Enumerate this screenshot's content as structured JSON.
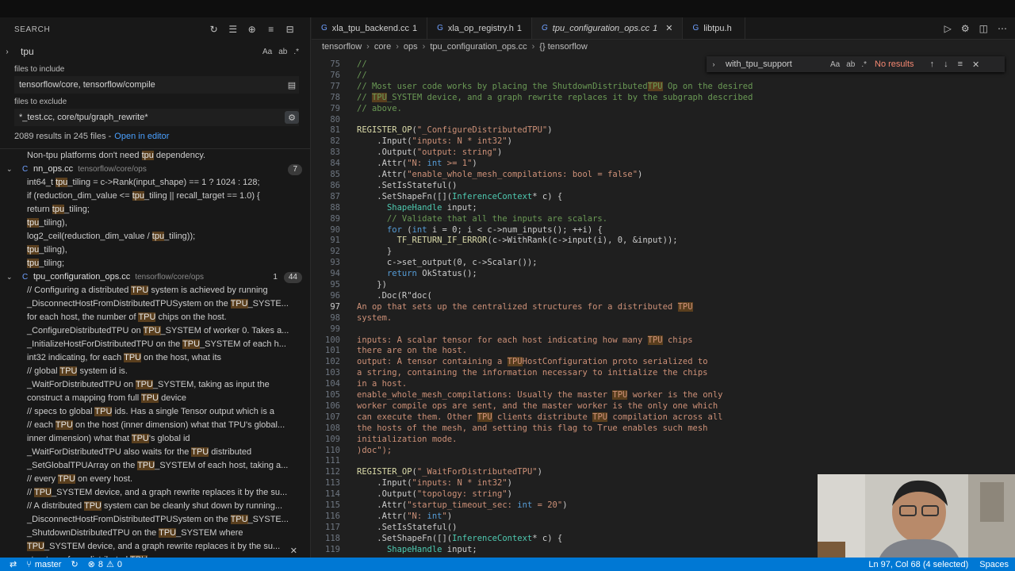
{
  "sidebar": {
    "title": "SEARCH",
    "query": "tpu",
    "include_label": "files to include",
    "include_value": "tensorflow/core, tensorflow/compile",
    "exclude_label": "files to exclude",
    "exclude_value": "*_test.cc, core/tpu/graph_rewrite*",
    "summary": "2089 results in 245 files -",
    "open_in_editor": "Open in editor",
    "results": [
      {
        "kind": "line",
        "pre": "Non-tpu platforms don't need ",
        "hl": "tpu",
        "post": " dependency."
      },
      {
        "kind": "file",
        "name": "nn_ops.cc",
        "path": "tensorflow/core/ops",
        "badge": "7"
      },
      {
        "kind": "line",
        "pre": "int64_t ",
        "hl": "tpu",
        "post": "_tiling = c->Rank(input_shape) == 1 ? 1024 : 128;"
      },
      {
        "kind": "line",
        "pre": "if (reduction_dim_value <= ",
        "hl": "tpu",
        "post": "_tiling || recall_target == 1.0) {"
      },
      {
        "kind": "line",
        "pre": "return ",
        "hl": "tpu",
        "post": "_tiling;"
      },
      {
        "kind": "line",
        "pre": "",
        "hl": "tpu",
        "post": "_tiling),"
      },
      {
        "kind": "line",
        "pre": "log2_ceil(reduction_dim_value / ",
        "hl": "tpu",
        "post": "_tiling));"
      },
      {
        "kind": "line",
        "pre": "",
        "hl": "tpu",
        "post": "_tiling),"
      },
      {
        "kind": "line",
        "pre": "",
        "hl": "tpu",
        "post": "_tiling;"
      },
      {
        "kind": "file",
        "name": "tpu_configuration_ops.cc",
        "path": "tensorflow/core/ops",
        "num": "1",
        "badge": "44"
      },
      {
        "kind": "line",
        "pre": "// Configuring a distributed ",
        "hl": "TPU",
        "post": " system is achieved by running"
      },
      {
        "kind": "line",
        "pre": "_DisconnectHostFromDistributedTPUSystem on the ",
        "hl": "TPU",
        "post": "_SYSTE..."
      },
      {
        "kind": "line",
        "pre": "for each host, the number of ",
        "hl": "TPU",
        "post": " chips on the host."
      },
      {
        "kind": "line",
        "pre": "_ConfigureDistributedTPU on ",
        "hl": "TPU",
        "post": "_SYSTEM of worker 0. Takes a..."
      },
      {
        "kind": "line",
        "pre": "_InitializeHostForDistributedTPU on the ",
        "hl": "TPU",
        "post": "_SYSTEM of each h..."
      },
      {
        "kind": "line",
        "pre": "int32 indicating, for each ",
        "hl": "TPU",
        "post": " on the host, what its"
      },
      {
        "kind": "line",
        "pre": "// global ",
        "hl": "TPU",
        "post": " system id is."
      },
      {
        "kind": "line",
        "pre": "_WaitForDistributedTPU on ",
        "hl": "TPU",
        "post": "_SYSTEM, taking as input the"
      },
      {
        "kind": "line",
        "pre": "construct a mapping from full ",
        "hl": "TPU",
        "post": " device"
      },
      {
        "kind": "line",
        "pre": "// specs to global ",
        "hl": "TPU",
        "post": " ids. Has a single Tensor output which is a"
      },
      {
        "kind": "line",
        "pre": "// each ",
        "hl": "TPU",
        "post": " on the host (inner dimension) what that TPU's global..."
      },
      {
        "kind": "line",
        "pre": "inner dimension) what that ",
        "hl": "TPU",
        "post": "'s global id"
      },
      {
        "kind": "line",
        "pre": "_WaitForDistributedTPU also waits for the ",
        "hl": "TPU",
        "post": " distributed"
      },
      {
        "kind": "line",
        "pre": "_SetGlobalTPUArray on the ",
        "hl": "TPU",
        "post": "_SYSTEM of each host, taking a..."
      },
      {
        "kind": "line",
        "pre": "// every ",
        "hl": "TPU",
        "post": " on every host."
      },
      {
        "kind": "line",
        "pre": "// ",
        "hl": "TPU",
        "post": "_SYSTEM device, and a graph rewrite replaces it by the su..."
      },
      {
        "kind": "line",
        "pre": "// A distributed ",
        "hl": "TPU",
        "post": " system can be cleanly shut down by running..."
      },
      {
        "kind": "line",
        "pre": "_DisconnectHostFromDistributedTPUSystem on the ",
        "hl": "TPU",
        "post": "_SYSTE..."
      },
      {
        "kind": "line",
        "pre": "_ShutdownDistributedTPU on the ",
        "hl": "TPU",
        "post": "_SYSTEM where"
      },
      {
        "kind": "line",
        "pre": "",
        "hl": "TPU",
        "post": "_SYSTEM device, and a graph rewrite replaces it by the su..."
      },
      {
        "kind": "line",
        "pre": "structures for a distributed ",
        "hl": "TPU",
        "post": ""
      }
    ]
  },
  "tabs": [
    {
      "name": "xla_tpu_backend.cc",
      "count": "1",
      "active": false
    },
    {
      "name": "xla_op_registry.h",
      "count": "1",
      "active": false
    },
    {
      "name": "tpu_configuration_ops.cc",
      "count": "1",
      "active": true
    },
    {
      "name": "libtpu.h",
      "count": "",
      "active": false
    }
  ],
  "breadcrumbs": [
    "tensorflow",
    "core",
    "ops",
    "tpu_configuration_ops.cc",
    "{} tensorflow"
  ],
  "find_widget": {
    "query": "with_tpu_support",
    "result": "No results"
  },
  "code": [
    {
      "n": "75",
      "t": "//",
      "c": "cm"
    },
    {
      "n": "76",
      "t": "//",
      "c": "cm"
    },
    {
      "n": "77",
      "t": "// Most user code works by placing the ShutdownDistributedTPU Op on the desired",
      "c": "cm"
    },
    {
      "n": "78",
      "t": "// TPU_SYSTEM device, and a graph rewrite replaces it by the subgraph described",
      "c": "cm"
    },
    {
      "n": "79",
      "t": "// above.",
      "c": "cm"
    },
    {
      "n": "80",
      "t": "",
      "c": ""
    },
    {
      "n": "81",
      "t": "REGISTER_OP(\"_ConfigureDistributedTPU\")",
      "c": ""
    },
    {
      "n": "82",
      "t": "    .Input(\"inputs: N * int32\")",
      "c": ""
    },
    {
      "n": "83",
      "t": "    .Output(\"output: string\")",
      "c": ""
    },
    {
      "n": "84",
      "t": "    .Attr(\"N: int >= 1\")",
      "c": ""
    },
    {
      "n": "85",
      "t": "    .Attr(\"enable_whole_mesh_compilations: bool = false\")",
      "c": ""
    },
    {
      "n": "86",
      "t": "    .SetIsStateful()",
      "c": ""
    },
    {
      "n": "87",
      "t": "    .SetShapeFn([](InferenceContext* c) {",
      "c": ""
    },
    {
      "n": "88",
      "t": "      ShapeHandle input;",
      "c": ""
    },
    {
      "n": "89",
      "t": "      // Validate that all the inputs are scalars.",
      "c": "cm"
    },
    {
      "n": "90",
      "t": "      for (int i = 0; i < c->num_inputs(); ++i) {",
      "c": ""
    },
    {
      "n": "91",
      "t": "        TF_RETURN_IF_ERROR(c->WithRank(c->input(i), 0, &input));",
      "c": ""
    },
    {
      "n": "92",
      "t": "      }",
      "c": ""
    },
    {
      "n": "93",
      "t": "      c->set_output(0, c->Scalar());",
      "c": ""
    },
    {
      "n": "94",
      "t": "      return OkStatus();",
      "c": ""
    },
    {
      "n": "95",
      "t": "    })",
      "c": ""
    },
    {
      "n": "96",
      "t": "    .Doc(R\"doc(",
      "c": ""
    },
    {
      "n": "97",
      "t": "An op that sets up the centralized structures for a distributed TPU",
      "c": "str"
    },
    {
      "n": "98",
      "t": "system.",
      "c": "str"
    },
    {
      "n": "99",
      "t": "",
      "c": ""
    },
    {
      "n": "100",
      "t": "inputs: A scalar tensor for each host indicating how many TPU chips",
      "c": "str"
    },
    {
      "n": "101",
      "t": "there are on the host.",
      "c": "str"
    },
    {
      "n": "102",
      "t": "output: A tensor containing a TPUHostConfiguration proto serialized to",
      "c": "str"
    },
    {
      "n": "103",
      "t": "a string, containing the information necessary to initialize the chips",
      "c": "str"
    },
    {
      "n": "104",
      "t": "in a host.",
      "c": "str"
    },
    {
      "n": "105",
      "t": "enable_whole_mesh_compilations: Usually the master TPU worker is the only",
      "c": "str"
    },
    {
      "n": "106",
      "t": "worker compile ops are sent, and the master worker is the only one which",
      "c": "str"
    },
    {
      "n": "107",
      "t": "can execute them. Other TPU clients distribute TPU compilation across all",
      "c": "str"
    },
    {
      "n": "108",
      "t": "the hosts of the mesh, and setting this flag to True enables such mesh",
      "c": "str"
    },
    {
      "n": "109",
      "t": "initialization mode.",
      "c": "str"
    },
    {
      "n": "110",
      "t": ")doc\");",
      "c": "str"
    },
    {
      "n": "111",
      "t": "",
      "c": ""
    },
    {
      "n": "112",
      "t": "REGISTER_OP(\"_WaitForDistributedTPU\")",
      "c": ""
    },
    {
      "n": "113",
      "t": "    .Input(\"inputs: N * int32\")",
      "c": ""
    },
    {
      "n": "114",
      "t": "    .Output(\"topology: string\")",
      "c": ""
    },
    {
      "n": "115",
      "t": "    .Attr(\"startup_timeout_sec: int = 20\")",
      "c": ""
    },
    {
      "n": "116",
      "t": "    .Attr(\"N: int\")",
      "c": ""
    },
    {
      "n": "117",
      "t": "    .SetIsStateful()",
      "c": ""
    },
    {
      "n": "118",
      "t": "    .SetShapeFn([](InferenceContext* c) {",
      "c": ""
    },
    {
      "n": "119",
      "t": "      ShapeHandle input;",
      "c": ""
    }
  ],
  "statusbar": {
    "branch": "master",
    "problems": "8",
    "warnings": "0",
    "position": "Ln 97, Col 68 (4 selected)",
    "spaces": "Spaces"
  },
  "colors": {
    "accent": "#0078d4",
    "match_highlight": "#5a3f1e",
    "comment": "#6a9955",
    "string": "#ce9178"
  }
}
